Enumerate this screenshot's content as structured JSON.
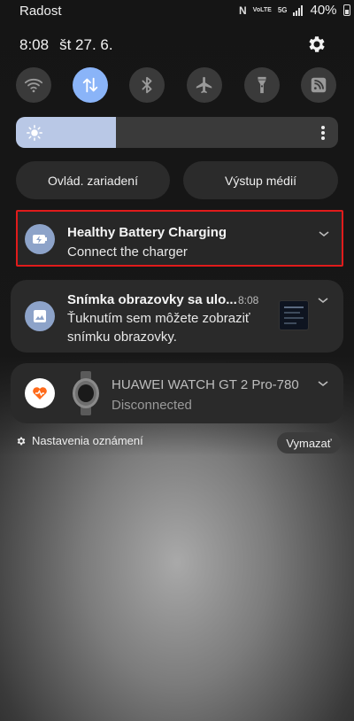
{
  "status_bar": {
    "carrier": "Radost",
    "nfc_glyph": "N",
    "volte_glyph": "VoLTE",
    "network_glyph": "5G",
    "battery": "40%"
  },
  "header": {
    "time": "8:08",
    "date": "št 27. 6."
  },
  "quick_settings": {
    "toggles": [
      {
        "icon": "wifi-icon",
        "active": false
      },
      {
        "icon": "mobile-data-icon",
        "active": true
      },
      {
        "icon": "bluetooth-icon",
        "active": false
      },
      {
        "icon": "airplane-icon",
        "active": false
      },
      {
        "icon": "flashlight-icon",
        "active": false
      },
      {
        "icon": "rss-icon",
        "active": false
      }
    ],
    "brightness_level": 0.31
  },
  "buttons": {
    "device_control": "Ovlád. zariadení",
    "media_output": "Výstup médií"
  },
  "notifications": [
    {
      "title": "Healthy Battery Charging",
      "text": "Connect the charger",
      "icon": "battery-charging-icon"
    },
    {
      "title": "Snímka obrazovky sa ulo...",
      "time": "8:08",
      "text_line1": "Ťuknutím sem môžete zobraziť",
      "text_line2": "snímku obrazovky.",
      "icon": "image-icon"
    },
    {
      "title": "HUAWEI WATCH GT 2 Pro-780",
      "status": "Disconnected",
      "icon": "huawei-health-icon"
    }
  ],
  "footer": {
    "notification_settings": "Nastavenia oznámení",
    "clear": "Vymazať"
  },
  "colors": {
    "accent": "#8ab4f8",
    "highlight_border": "#e01b1b",
    "huawei_orange": "#ff6a1a"
  }
}
